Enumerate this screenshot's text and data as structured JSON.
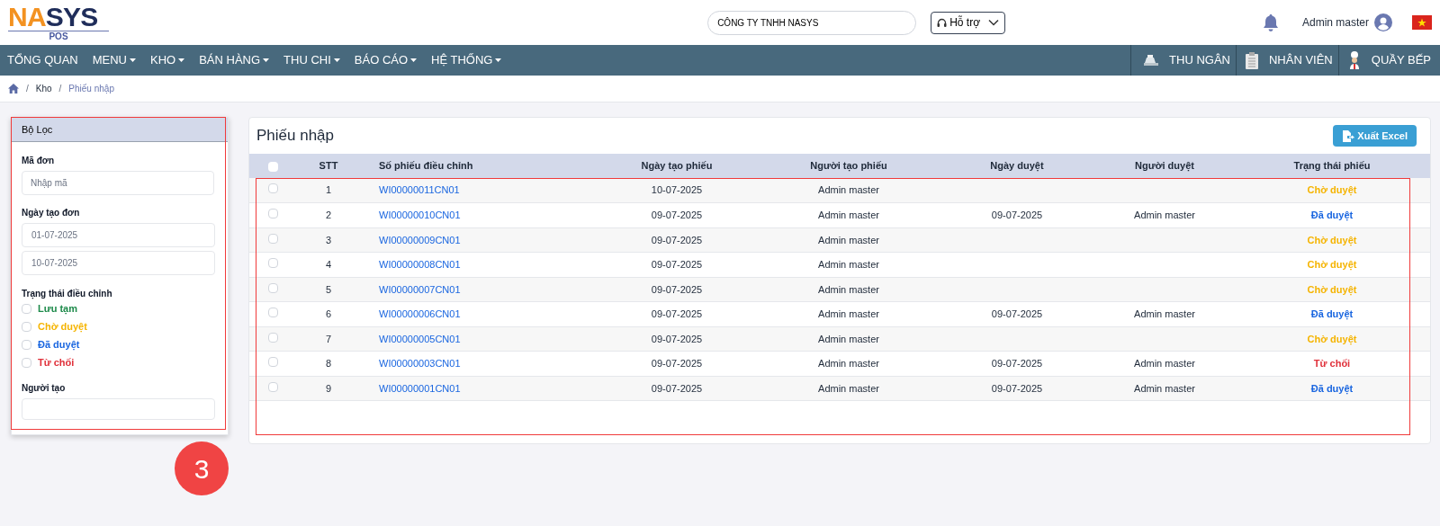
{
  "header": {
    "logo": {
      "main_left": "NA",
      "main_mid": "S",
      "main_right": "YS",
      "sub": "POS"
    },
    "company": "CÔNG TY TNHH NASYS",
    "support": "Hỗ trợ",
    "user": "Admin master"
  },
  "nav": {
    "items": [
      {
        "label": "TỔNG QUAN",
        "dropdown": false
      },
      {
        "label": "MENU",
        "dropdown": true
      },
      {
        "label": "KHO",
        "dropdown": true
      },
      {
        "label": "BÁN HÀNG",
        "dropdown": true
      },
      {
        "label": "THU CHI",
        "dropdown": true
      },
      {
        "label": "BÁO CÁO",
        "dropdown": true
      },
      {
        "label": "HỆ THỐNG",
        "dropdown": true
      }
    ],
    "right_items": [
      {
        "label": "THU NGÂN",
        "kind": "cashier"
      },
      {
        "label": "NHÂN VIÊN",
        "kind": "staff"
      },
      {
        "label": "QUẦY BẾP",
        "kind": "kitchen"
      }
    ]
  },
  "breadcrumb": [
    {
      "separator": "/",
      "label": "Kho"
    },
    {
      "separator": "/",
      "label": "Phiếu nhập"
    }
  ],
  "filter": {
    "title": "Bộ Lọc",
    "code_label": "Mã đơn",
    "code_placeholder": "Nhập mã",
    "date_label": "Ngày tạo đơn",
    "date_from": "01-07-2025",
    "date_to": "10-07-2025",
    "status_label": "Trạng thái điều chỉnh",
    "statuses": [
      {
        "label": "Lưu tạm",
        "kind": "draft",
        "checked": false
      },
      {
        "label": "Chờ duyệt",
        "kind": "pending",
        "checked": false
      },
      {
        "label": "Đã duyệt",
        "kind": "approved",
        "checked": false
      },
      {
        "label": "Từ chối",
        "kind": "rejected",
        "checked": false
      }
    ],
    "creator_label": "Người tạo"
  },
  "main": {
    "title": "Phiếu nhập",
    "export_button": "Xuất Excel",
    "table": {
      "select_all_checked": false,
      "columns": [
        "STT",
        "Số phiếu điều chỉnh",
        "Ngày tạo phiếu",
        "Người tạo phiếu",
        "Ngày duyệt",
        "Người duyệt",
        "Trạng thái phiếu"
      ],
      "rows": [
        {
          "checked": false,
          "stt": "1",
          "code": "WI00000011CN01",
          "created": "10-07-2025",
          "creator": "Admin master",
          "status": "Chờ duyệt",
          "kind": "pending"
        },
        {
          "checked": false,
          "stt": "2",
          "code": "WI00000010CN01",
          "created": "09-07-2025",
          "creator": "Admin master",
          "approved": "09-07-2025",
          "approver": "Admin master",
          "status": "Đã duyệt",
          "kind": "approved"
        },
        {
          "checked": false,
          "stt": "3",
          "code": "WI00000009CN01",
          "created": "09-07-2025",
          "creator": "Admin master",
          "status": "Chờ duyệt",
          "kind": "pending"
        },
        {
          "checked": false,
          "stt": "4",
          "code": "WI00000008CN01",
          "created": "09-07-2025",
          "creator": "Admin master",
          "status": "Chờ duyệt",
          "kind": "pending"
        },
        {
          "checked": false,
          "stt": "5",
          "code": "WI00000007CN01",
          "created": "09-07-2025",
          "creator": "Admin master",
          "status": "Chờ duyệt",
          "kind": "pending"
        },
        {
          "checked": false,
          "stt": "6",
          "code": "WI00000006CN01",
          "created": "09-07-2025",
          "creator": "Admin master",
          "approved": "09-07-2025",
          "approver": "Admin master",
          "status": "Đã duyệt",
          "kind": "approved"
        },
        {
          "checked": false,
          "stt": "7",
          "code": "WI00000005CN01",
          "created": "09-07-2025",
          "creator": "Admin master",
          "status": "Chờ duyệt",
          "kind": "pending"
        },
        {
          "checked": false,
          "stt": "8",
          "code": "WI00000003CN01",
          "created": "09-07-2025",
          "creator": "Admin master",
          "approved": "09-07-2025",
          "approver": "Admin master",
          "status": "Từ chối",
          "kind": "rejected"
        },
        {
          "checked": false,
          "stt": "9",
          "code": "WI00000001CN01",
          "created": "09-07-2025",
          "creator": "Admin master",
          "approved": "09-07-2025",
          "approver": "Admin master",
          "status": "Đã duyệt",
          "kind": "approved"
        }
      ]
    }
  },
  "annotation": {
    "step": "3"
  }
}
